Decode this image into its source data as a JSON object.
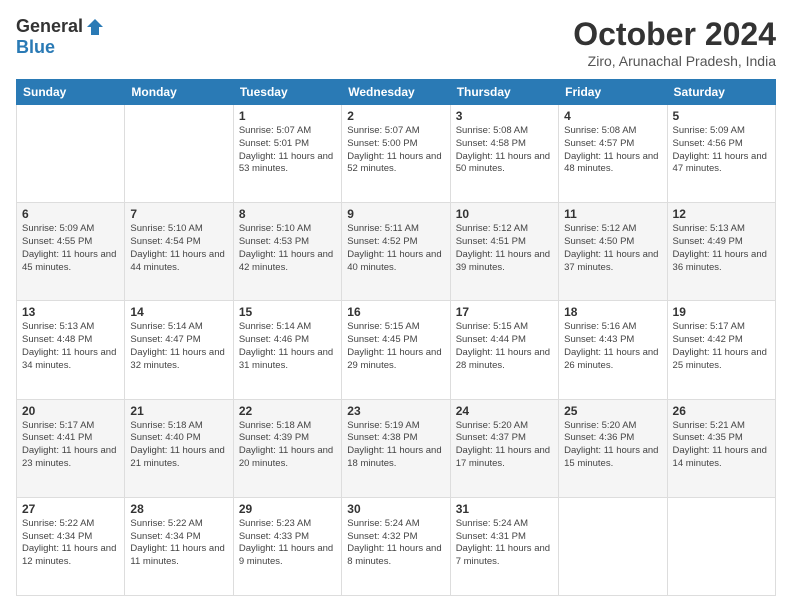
{
  "header": {
    "logo_general": "General",
    "logo_blue": "Blue",
    "title": "October 2024",
    "location": "Ziro, Arunachal Pradesh, India"
  },
  "columns": [
    "Sunday",
    "Monday",
    "Tuesday",
    "Wednesday",
    "Thursday",
    "Friday",
    "Saturday"
  ],
  "weeks": [
    [
      {
        "day": "",
        "info": ""
      },
      {
        "day": "",
        "info": ""
      },
      {
        "day": "1",
        "info": "Sunrise: 5:07 AM\nSunset: 5:01 PM\nDaylight: 11 hours and 53 minutes."
      },
      {
        "day": "2",
        "info": "Sunrise: 5:07 AM\nSunset: 5:00 PM\nDaylight: 11 hours and 52 minutes."
      },
      {
        "day": "3",
        "info": "Sunrise: 5:08 AM\nSunset: 4:58 PM\nDaylight: 11 hours and 50 minutes."
      },
      {
        "day": "4",
        "info": "Sunrise: 5:08 AM\nSunset: 4:57 PM\nDaylight: 11 hours and 48 minutes."
      },
      {
        "day": "5",
        "info": "Sunrise: 5:09 AM\nSunset: 4:56 PM\nDaylight: 11 hours and 47 minutes."
      }
    ],
    [
      {
        "day": "6",
        "info": "Sunrise: 5:09 AM\nSunset: 4:55 PM\nDaylight: 11 hours and 45 minutes."
      },
      {
        "day": "7",
        "info": "Sunrise: 5:10 AM\nSunset: 4:54 PM\nDaylight: 11 hours and 44 minutes."
      },
      {
        "day": "8",
        "info": "Sunrise: 5:10 AM\nSunset: 4:53 PM\nDaylight: 11 hours and 42 minutes."
      },
      {
        "day": "9",
        "info": "Sunrise: 5:11 AM\nSunset: 4:52 PM\nDaylight: 11 hours and 40 minutes."
      },
      {
        "day": "10",
        "info": "Sunrise: 5:12 AM\nSunset: 4:51 PM\nDaylight: 11 hours and 39 minutes."
      },
      {
        "day": "11",
        "info": "Sunrise: 5:12 AM\nSunset: 4:50 PM\nDaylight: 11 hours and 37 minutes."
      },
      {
        "day": "12",
        "info": "Sunrise: 5:13 AM\nSunset: 4:49 PM\nDaylight: 11 hours and 36 minutes."
      }
    ],
    [
      {
        "day": "13",
        "info": "Sunrise: 5:13 AM\nSunset: 4:48 PM\nDaylight: 11 hours and 34 minutes."
      },
      {
        "day": "14",
        "info": "Sunrise: 5:14 AM\nSunset: 4:47 PM\nDaylight: 11 hours and 32 minutes."
      },
      {
        "day": "15",
        "info": "Sunrise: 5:14 AM\nSunset: 4:46 PM\nDaylight: 11 hours and 31 minutes."
      },
      {
        "day": "16",
        "info": "Sunrise: 5:15 AM\nSunset: 4:45 PM\nDaylight: 11 hours and 29 minutes."
      },
      {
        "day": "17",
        "info": "Sunrise: 5:15 AM\nSunset: 4:44 PM\nDaylight: 11 hours and 28 minutes."
      },
      {
        "day": "18",
        "info": "Sunrise: 5:16 AM\nSunset: 4:43 PM\nDaylight: 11 hours and 26 minutes."
      },
      {
        "day": "19",
        "info": "Sunrise: 5:17 AM\nSunset: 4:42 PM\nDaylight: 11 hours and 25 minutes."
      }
    ],
    [
      {
        "day": "20",
        "info": "Sunrise: 5:17 AM\nSunset: 4:41 PM\nDaylight: 11 hours and 23 minutes."
      },
      {
        "day": "21",
        "info": "Sunrise: 5:18 AM\nSunset: 4:40 PM\nDaylight: 11 hours and 21 minutes."
      },
      {
        "day": "22",
        "info": "Sunrise: 5:18 AM\nSunset: 4:39 PM\nDaylight: 11 hours and 20 minutes."
      },
      {
        "day": "23",
        "info": "Sunrise: 5:19 AM\nSunset: 4:38 PM\nDaylight: 11 hours and 18 minutes."
      },
      {
        "day": "24",
        "info": "Sunrise: 5:20 AM\nSunset: 4:37 PM\nDaylight: 11 hours and 17 minutes."
      },
      {
        "day": "25",
        "info": "Sunrise: 5:20 AM\nSunset: 4:36 PM\nDaylight: 11 hours and 15 minutes."
      },
      {
        "day": "26",
        "info": "Sunrise: 5:21 AM\nSunset: 4:35 PM\nDaylight: 11 hours and 14 minutes."
      }
    ],
    [
      {
        "day": "27",
        "info": "Sunrise: 5:22 AM\nSunset: 4:34 PM\nDaylight: 11 hours and 12 minutes."
      },
      {
        "day": "28",
        "info": "Sunrise: 5:22 AM\nSunset: 4:34 PM\nDaylight: 11 hours and 11 minutes."
      },
      {
        "day": "29",
        "info": "Sunrise: 5:23 AM\nSunset: 4:33 PM\nDaylight: 11 hours and 9 minutes."
      },
      {
        "day": "30",
        "info": "Sunrise: 5:24 AM\nSunset: 4:32 PM\nDaylight: 11 hours and 8 minutes."
      },
      {
        "day": "31",
        "info": "Sunrise: 5:24 AM\nSunset: 4:31 PM\nDaylight: 11 hours and 7 minutes."
      },
      {
        "day": "",
        "info": ""
      },
      {
        "day": "",
        "info": ""
      }
    ]
  ]
}
